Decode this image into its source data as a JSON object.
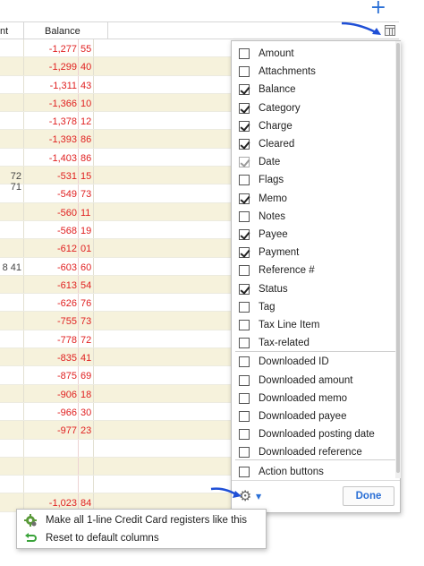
{
  "toolbar": {
    "add_icon": "plus-icon"
  },
  "header": {
    "prev_col_label": "nt",
    "balance_label": "Balance"
  },
  "rows": [
    {
      "left": "",
      "int": "-1,277",
      "dec": "55",
      "alt": false
    },
    {
      "left": "",
      "int": "-1,299",
      "dec": "40",
      "alt": true
    },
    {
      "left": "",
      "int": "-1,311",
      "dec": "43",
      "alt": false
    },
    {
      "left": "",
      "int": "-1,366",
      "dec": "10",
      "alt": true
    },
    {
      "left": "",
      "int": "-1,378",
      "dec": "12",
      "alt": false
    },
    {
      "left": "",
      "int": "-1,393",
      "dec": "86",
      "alt": true
    },
    {
      "left": "",
      "int": "-1,403",
      "dec": "86",
      "alt": false
    },
    {
      "left": "72 71",
      "int": "-531",
      "dec": "15",
      "alt": true
    },
    {
      "left": "",
      "int": "-549",
      "dec": "73",
      "alt": false
    },
    {
      "left": "",
      "int": "-560",
      "dec": "11",
      "alt": true
    },
    {
      "left": "",
      "int": "-568",
      "dec": "19",
      "alt": false
    },
    {
      "left": "",
      "int": "-612",
      "dec": "01",
      "alt": true
    },
    {
      "left": "8 41",
      "int": "-603",
      "dec": "60",
      "alt": false
    },
    {
      "left": "",
      "int": "-613",
      "dec": "54",
      "alt": true
    },
    {
      "left": "",
      "int": "-626",
      "dec": "76",
      "alt": false
    },
    {
      "left": "",
      "int": "-755",
      "dec": "73",
      "alt": true
    },
    {
      "left": "",
      "int": "-778",
      "dec": "72",
      "alt": false
    },
    {
      "left": "",
      "int": "-835",
      "dec": "41",
      "alt": true
    },
    {
      "left": "",
      "int": "-875",
      "dec": "69",
      "alt": false
    },
    {
      "left": "",
      "int": "-906",
      "dec": "18",
      "alt": true
    },
    {
      "left": "",
      "int": "-966",
      "dec": "30",
      "alt": false
    },
    {
      "left": "",
      "int": "-977",
      "dec": "23",
      "alt": true
    },
    {
      "left": "",
      "int": "",
      "dec": "",
      "alt": false
    },
    {
      "left": "",
      "int": "",
      "dec": "",
      "alt": true
    },
    {
      "left": "",
      "int": "",
      "dec": "",
      "alt": false
    },
    {
      "left": "",
      "int": "-1,023",
      "dec": "84",
      "alt": true
    }
  ],
  "column_popup": {
    "options": [
      {
        "label": "Amount",
        "checked": false,
        "disabled": false
      },
      {
        "label": "Attachments",
        "checked": false,
        "disabled": false
      },
      {
        "label": "Balance",
        "checked": true,
        "disabled": false
      },
      {
        "label": "Category",
        "checked": true,
        "disabled": false
      },
      {
        "label": "Charge",
        "checked": true,
        "disabled": false
      },
      {
        "label": "Cleared",
        "checked": true,
        "disabled": false
      },
      {
        "label": "Date",
        "checked": true,
        "disabled": true
      },
      {
        "label": "Flags",
        "checked": false,
        "disabled": false
      },
      {
        "label": "Memo",
        "checked": true,
        "disabled": false
      },
      {
        "label": "Notes",
        "checked": false,
        "disabled": false
      },
      {
        "label": "Payee",
        "checked": true,
        "disabled": false
      },
      {
        "label": "Payment",
        "checked": true,
        "disabled": false
      },
      {
        "label": "Reference #",
        "checked": false,
        "disabled": false
      },
      {
        "label": "Status",
        "checked": true,
        "disabled": false
      },
      {
        "label": "Tag",
        "checked": false,
        "disabled": false
      },
      {
        "label": "Tax Line Item",
        "checked": false,
        "disabled": false
      },
      {
        "label": "Tax-related",
        "checked": false,
        "disabled": false
      },
      {
        "label": "Downloaded ID",
        "checked": false,
        "disabled": false
      },
      {
        "label": "Downloaded amount",
        "checked": false,
        "disabled": false
      },
      {
        "label": "Downloaded memo",
        "checked": false,
        "disabled": false
      },
      {
        "label": "Downloaded payee",
        "checked": false,
        "disabled": false
      },
      {
        "label": "Downloaded posting date",
        "checked": false,
        "disabled": false
      },
      {
        "label": "Downloaded reference",
        "checked": false,
        "disabled": false
      },
      {
        "label": "Action buttons",
        "checked": false,
        "disabled": false
      }
    ],
    "done_label": "Done",
    "gear_icon": "gear-icon"
  },
  "gear_menu": {
    "items": [
      {
        "label": "Make all 1-line Credit Card registers like this",
        "icon": "gear-green-icon"
      },
      {
        "label": "Reset to default columns",
        "icon": "reset-arrow-icon"
      }
    ]
  },
  "colors": {
    "accent": "#2a6fd6",
    "negative": "#e02020",
    "row_alt": "#f6f2dc"
  }
}
